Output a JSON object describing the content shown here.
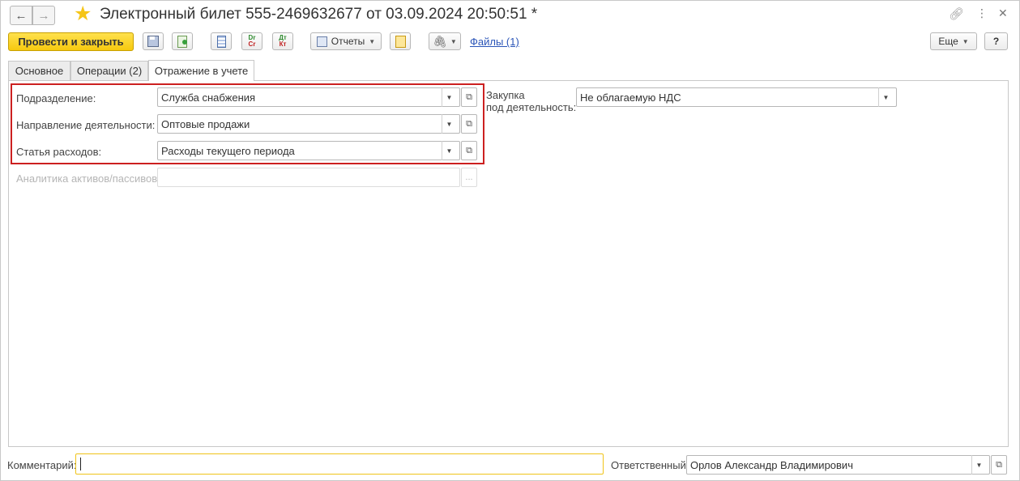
{
  "window": {
    "title": "Электронный билет 555-2469632677 от 03.09.2024 20:50:51 *"
  },
  "toolbar": {
    "post_close_label": "Провести и закрыть",
    "dr_cr": [
      "Dr",
      "Cr"
    ],
    "dt_kt": [
      "Дт",
      "Кт"
    ],
    "reports_label": "Отчеты",
    "files_link": "Файлы (1)",
    "more_label": "Еще",
    "help_label": "?"
  },
  "tabs": [
    {
      "label": "Основное",
      "active": false
    },
    {
      "label": "Операции (2)",
      "active": false
    },
    {
      "label": "Отражение в учете",
      "active": true
    }
  ],
  "form": {
    "department": {
      "label": "Подразделение:",
      "value": "Служба снабжения"
    },
    "activity": {
      "label": "Направление деятельности:",
      "value": "Оптовые продажи"
    },
    "expense": {
      "label": "Статья расходов:",
      "value": "Расходы текущего периода"
    },
    "analytics": {
      "label": "Аналитика активов/пассивов:",
      "value": "",
      "button": "..."
    },
    "purchase": {
      "label_line1": "Закупка",
      "label_line2": "под деятельность:",
      "value": "Не облагаемую НДС"
    }
  },
  "footer": {
    "comment_label": "Комментарий:",
    "comment_value": "",
    "responsible_label": "Ответственный:",
    "responsible_value": "Орлов Александр Владимирович"
  },
  "colors": {
    "primary_button": "#f6c90e",
    "highlight_border": "#cc2020",
    "link": "#2b55b8",
    "star": "#f5c518"
  }
}
